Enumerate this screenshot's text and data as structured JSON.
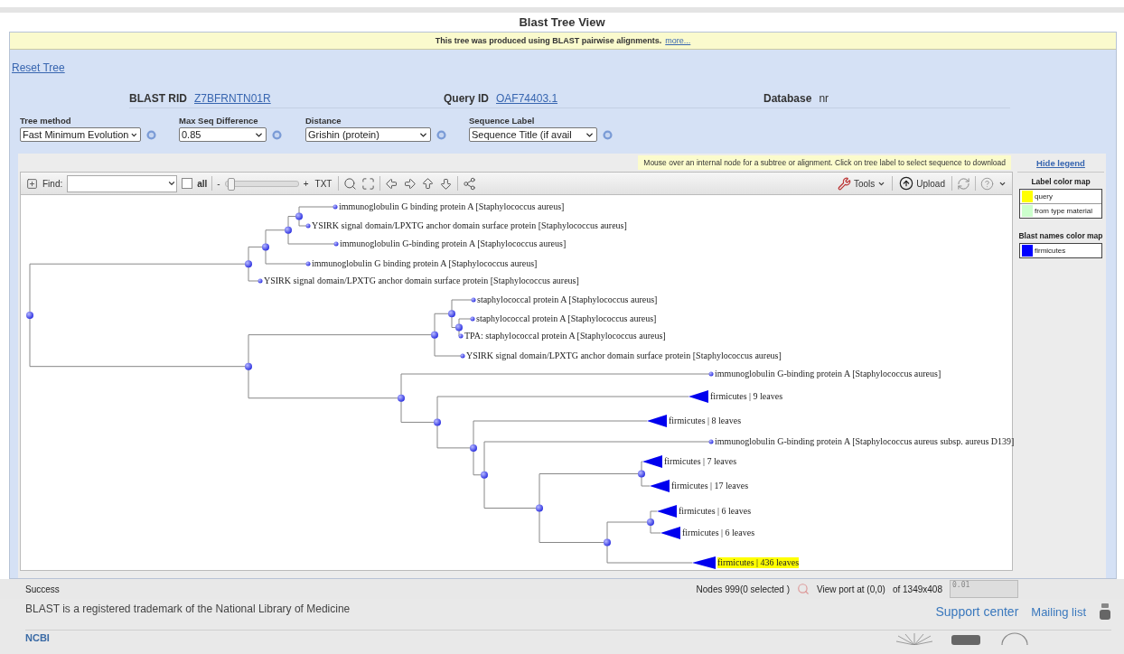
{
  "page_title": "Blast Tree View",
  "banner": {
    "text": "This tree was produced using BLAST pairwise alignments.",
    "link": "more..."
  },
  "reset_link": "Reset Tree",
  "info": [
    {
      "label": "BLAST RID",
      "value": "Z7BFRNTN01R",
      "kind": "link"
    },
    {
      "label": "Query ID",
      "value": "OAF74403.1",
      "kind": "link"
    },
    {
      "label": "Database",
      "value": "nr",
      "kind": "text"
    }
  ],
  "options": [
    {
      "label": "Tree method",
      "value": "Fast Minimum Evolution"
    },
    {
      "label": "Max Seq Difference",
      "value": "0.85"
    },
    {
      "label": "Distance",
      "value": "Grishin (protein)"
    },
    {
      "label": "Sequence Label",
      "value": "Sequence Title (if avail"
    }
  ],
  "hint": "Mouse over an internal node for a subtree or alignment. Click on tree label to select sequence to download",
  "hide_legend": "Hide legend",
  "toolbar": {
    "find_label": "Find:",
    "all": {
      "label": "all",
      "checked": false
    },
    "zoom_out": "-",
    "zoom_slider": {
      "level": 0.03
    },
    "zoom_in": "+",
    "txt": "TXT",
    "tools": "Tools",
    "upload": "Upload"
  },
  "tree": {
    "kind": "node",
    "children": [
      {
        "kind": "node",
        "children": [
          {
            "kind": "node",
            "children": [
              {
                "kind": "node",
                "children": [
                  {
                    "kind": "node",
                    "children": [
                      {
                        "kind": "leaf",
                        "label": "immunoglobulin G binding protein A [Staphylococcus aureus]",
                        "query": false
                      },
                      {
                        "kind": "leaf",
                        "label": "YSIRK signal domain/LPXTG anchor domain surface protein [Staphylococcus aureus]",
                        "query": false
                      }
                    ]
                  },
                  {
                    "kind": "leaf",
                    "label": "immunoglobulin G-binding protein A [Staphylococcus aureus]",
                    "query": false
                  }
                ]
              },
              {
                "kind": "leaf",
                "label": "immunoglobulin G binding protein A [Staphylococcus aureus]",
                "query": false
              }
            ]
          },
          {
            "kind": "leaf",
            "label": "YSIRK signal domain/LPXTG anchor domain surface protein [Staphylococcus aureus]",
            "query": false
          }
        ]
      },
      {
        "kind": "node",
        "children": [
          {
            "kind": "node",
            "children": [
              {
                "kind": "node",
                "children": [
                  {
                    "kind": "leaf",
                    "label": "staphylococcal protein A [Staphylococcus aureus]",
                    "query": false
                  },
                  {
                    "kind": "node",
                    "children": [
                      {
                        "kind": "leaf",
                        "label": "staphylococcal protein A [Staphylococcus aureus]",
                        "query": false
                      },
                      {
                        "kind": "leaf",
                        "label": "TPA: staphylococcal protein A [Staphylococcus aureus]",
                        "query": false
                      }
                    ]
                  }
                ]
              },
              {
                "kind": "leaf",
                "label": "YSIRK signal domain/LPXTG anchor domain surface protein [Staphylococcus aureus]",
                "query": false
              }
            ]
          },
          {
            "kind": "node",
            "children": [
              {
                "kind": "leaf",
                "label": "immunoglobulin G-binding protein A [Staphylococcus aureus]",
                "query": false
              },
              {
                "kind": "node",
                "children": [
                  {
                    "kind": "collapsed",
                    "label": "firmicutes | 9 leaves",
                    "query": false
                  },
                  {
                    "kind": "node",
                    "children": [
                      {
                        "kind": "collapsed",
                        "label": "firmicutes | 8 leaves",
                        "query": false
                      },
                      {
                        "kind": "node",
                        "children": [
                          {
                            "kind": "leaf",
                            "label": "immunoglobulin G-binding protein A [Staphylococcus aureus subsp. aureus D139]",
                            "query": false
                          },
                          {
                            "kind": "node",
                            "children": [
                              {
                                "kind": "node",
                                "children": [
                                  {
                                    "kind": "collapsed",
                                    "label": "firmicutes | 7 leaves",
                                    "query": false
                                  },
                                  {
                                    "kind": "collapsed",
                                    "label": "firmicutes | 17 leaves",
                                    "query": false
                                  }
                                ]
                              },
                              {
                                "kind": "node",
                                "children": [
                                  {
                                    "kind": "node",
                                    "children": [
                                      {
                                        "kind": "collapsed",
                                        "label": "firmicutes | 6 leaves",
                                        "query": false
                                      },
                                      {
                                        "kind": "collapsed",
                                        "label": "firmicutes | 6 leaves",
                                        "query": false
                                      }
                                    ]
                                  },
                                  {
                                    "kind": "collapsed",
                                    "label": "firmicutes | 436 leaves",
                                    "query": true
                                  }
                                ]
                              }
                            ]
                          }
                        ]
                      }
                    ]
                  }
                ]
              }
            ]
          }
        ]
      }
    ]
  },
  "legend": {
    "label_title": "Label color map",
    "label_items": [
      {
        "name": "query",
        "color": "#ffff00"
      },
      {
        "name": "from type material",
        "color": "#ccffcc"
      }
    ],
    "blast_title": "Blast names color map",
    "blast_items": [
      {
        "name": "firmicutes",
        "color": "#0000ff"
      }
    ]
  },
  "status": {
    "message": "Success",
    "nodes": "Nodes 999(0 selected )",
    "viewport": "View port at (0,0)",
    "size": "of 1349x408",
    "scale": "0.01"
  },
  "footer": {
    "trademark": "BLAST is a registered trademark of the National Library of Medicine",
    "links": [
      "Support center",
      "Mailing list"
    ],
    "brand": "NCBI"
  }
}
